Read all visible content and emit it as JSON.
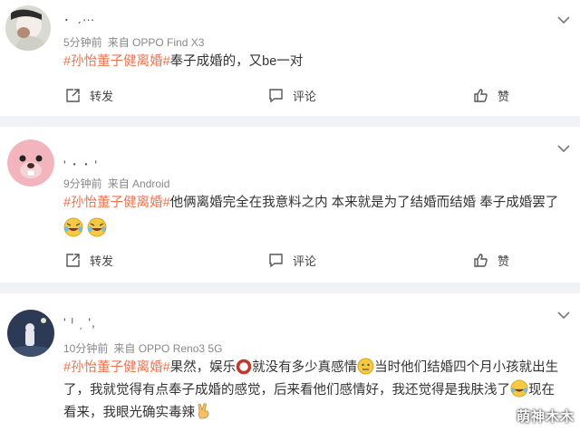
{
  "posts": [
    {
      "username": "．ˏ…",
      "time": "5分钟前",
      "source": "来自 OPPO Find X3",
      "tag": "#孙怡董子健离婚#",
      "text": "奉子成婚的，又be一对",
      "actions": {
        "repost": "转发",
        "comment": "评论",
        "like": "赞"
      }
    },
    {
      "username": "' ･ ･ '",
      "time": "9分钟前",
      "source": "来自 Android",
      "tag": "#孙怡董子健离婚#",
      "text": "他俩离婚完全在我意料之内 本来就是为了结婚而结婚 奉子成婚罢了",
      "actions": {
        "repost": "转发",
        "comment": "评论",
        "like": "赞"
      }
    },
    {
      "username": "' ᴵ ˌ ',",
      "time": "10分钟前",
      "source": "来自 OPPO Reno3 5G",
      "tag": "#孙怡董子健离婚#",
      "text_a": "果然，娱乐",
      "text_b": "就没有多少真感情",
      "text_c": "当时他们结婚四个月小孩就出生了，我就觉得有点奉子成婚的感觉，后来看他们感情好，我还觉得是我肤浅了",
      "text_d": "现在看来，我眼光确实毒辣"
    }
  ],
  "watermark": "萌神木木",
  "colors": {
    "tag": "#eb7350",
    "background": "#f1f2f5"
  }
}
